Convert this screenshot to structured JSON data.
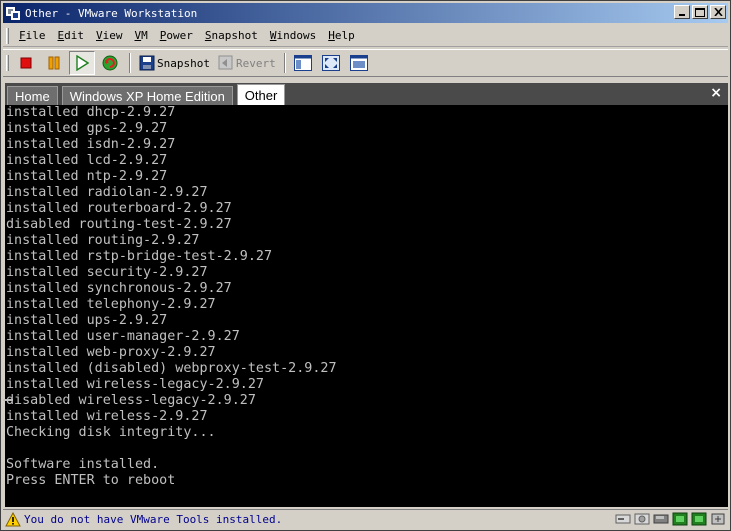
{
  "window": {
    "title": "Other - VMware Workstation"
  },
  "title_buttons": {
    "minimize": "_",
    "maximize": "□",
    "close": "✕"
  },
  "menu": [
    {
      "label": "File",
      "u": "F",
      "rest": "ile"
    },
    {
      "label": "Edit",
      "u": "E",
      "rest": "dit"
    },
    {
      "label": "View",
      "u": "V",
      "rest": "iew"
    },
    {
      "label": "VM",
      "u": "V",
      "rest": "M"
    },
    {
      "label": "Power",
      "u": "P",
      "rest": "ower"
    },
    {
      "label": "Snapshot",
      "u": "S",
      "rest": "napshot"
    },
    {
      "label": "Windows",
      "u": "W",
      "rest": "indows"
    },
    {
      "label": "Help",
      "u": "H",
      "rest": "elp"
    }
  ],
  "toolbar": {
    "snapshot_label": "Snapshot",
    "revert_label": "Revert"
  },
  "tabs": [
    {
      "label": "Home",
      "active": false
    },
    {
      "label": "Windows XP Home Edition",
      "active": false
    },
    {
      "label": "Other",
      "active": true
    }
  ],
  "tab_close": "×",
  "console": {
    "lines": [
      "installed dhcp-2.9.27",
      "installed gps-2.9.27",
      "installed isdn-2.9.27",
      "installed lcd-2.9.27",
      "installed ntp-2.9.27",
      "installed radiolan-2.9.27",
      "installed routerboard-2.9.27",
      "disabled routing-test-2.9.27",
      "installed routing-2.9.27",
      "installed rstp-bridge-test-2.9.27",
      "installed security-2.9.27",
      "installed synchronous-2.9.27",
      "installed telephony-2.9.27",
      "installed ups-2.9.27",
      "installed user-manager-2.9.27",
      "installed web-proxy-2.9.27",
      "installed (disabled) webproxy-test-2.9.27",
      "installed wireless-legacy-2.9.27",
      "disabled wireless-legacy-2.9.27",
      "installed wireless-2.9.27",
      "Checking disk integrity...",
      "",
      "Software installed.",
      "Press ENTER to reboot"
    ]
  },
  "status": {
    "message": "You do not have VMware Tools installed.",
    "icon": "warning-icon"
  },
  "colors": {
    "title_gradient_start": "#0a246a",
    "title_gradient_end": "#a6caf0",
    "console_bg": "#000000",
    "console_fg": "#c0c0c0",
    "status_text": "#00008b"
  }
}
